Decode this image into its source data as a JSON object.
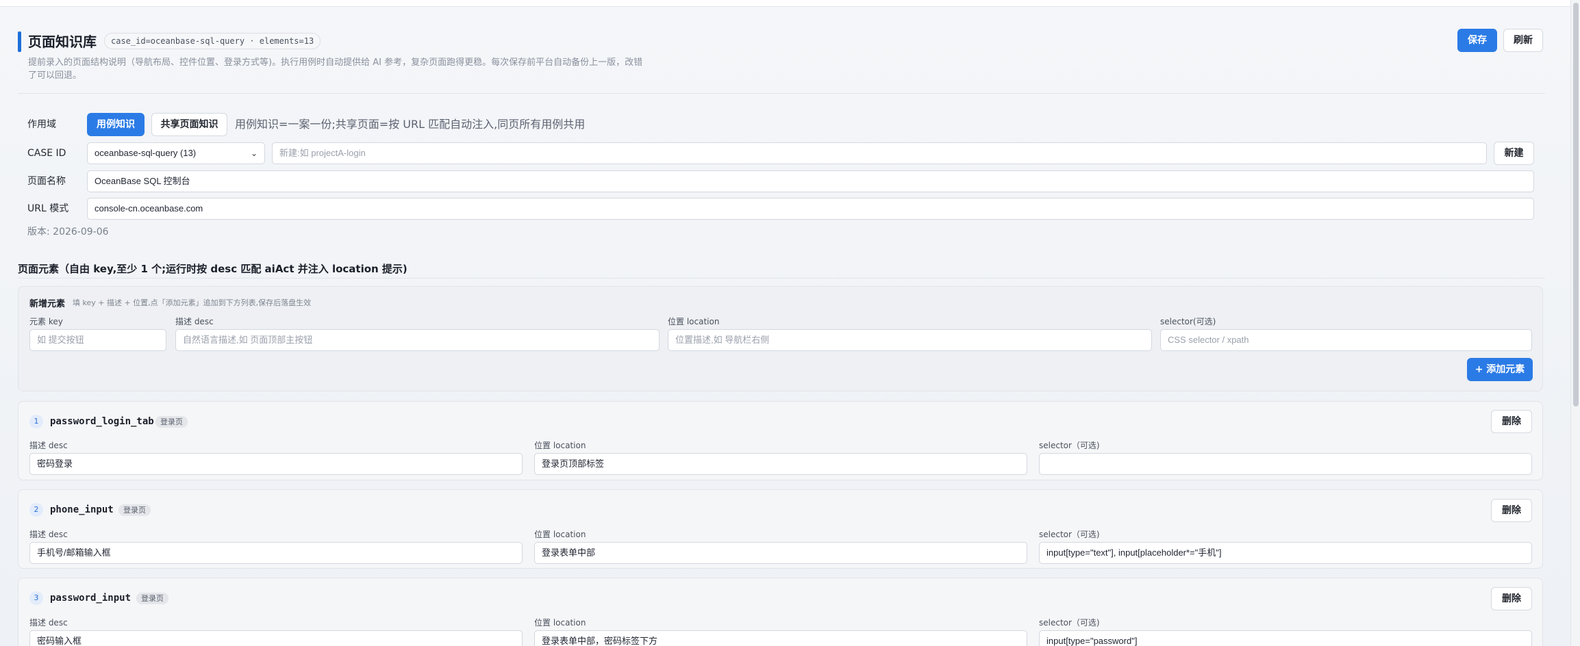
{
  "header": {
    "title": "页面知识库",
    "case_pill": "case_id=oceanbase-sql-query · elements=13",
    "description": "提前录入的页面结构说明（导航布局、控件位置、登录方式等)。执行用例时自动提供给 AI 参考，复杂页面跑得更稳。每次保存前平台自动备份上一版，改错了可以回退。",
    "save_label": "保存",
    "refresh_label": "刷新"
  },
  "scope": {
    "label": "作用域",
    "case_knowledge": "用例知识",
    "shared_knowledge": "共享页面知识",
    "hint": "用例知识=一案一份;共享页面=按 URL 匹配自动注入,同页所有用例共用"
  },
  "case_id": {
    "label": "CASE ID",
    "selected": "oceanbase-sql-query (13)",
    "new_placeholder": "新建:如 projectA-login",
    "new_button": "新建"
  },
  "page_name": {
    "label": "页面名称",
    "value": "OceanBase SQL 控制台"
  },
  "url_pattern": {
    "label": "URL 模式",
    "value": "console-cn.oceanbase.com"
  },
  "version": "版本: 2026-09-06",
  "elements_section": {
    "title": "页面元素（自由 key,至少 1 个;运行时按 desc 匹配 aiAct 并注入 location 提示)"
  },
  "new_element": {
    "title": "新增元素",
    "hint": "填 key + 描述 + 位置,点「添加元素」追加到下方列表,保存后落盘生效",
    "key_label": "元素 key",
    "key_placeholder": "如 提交按钮",
    "desc_label": "描述 desc",
    "desc_placeholder": "自然语言描述,如 页面顶部主按钮",
    "location_label": "位置 location",
    "location_placeholder": "位置描述,如 导航栏右侧",
    "selector_label": "selector(可选)",
    "selector_placeholder": "CSS selector / xpath",
    "add_button": "+ 添加元素"
  },
  "element_labels": {
    "desc": "描述 desc",
    "location": "位置 location",
    "selector": "selector（可选)",
    "delete": "删除"
  },
  "elements": [
    {
      "index": "1",
      "key": "password_login_tab",
      "tag": "登录页",
      "desc": "密码登录",
      "location": "登录页顶部标签",
      "selector": ""
    },
    {
      "index": "2",
      "key": "phone_input",
      "tag": "登录页",
      "desc": "手机号/邮箱输入框",
      "location": "登录表单中部",
      "selector": "input[type=\"text\"], input[placeholder*=\"手机\"]"
    },
    {
      "index": "3",
      "key": "password_input",
      "tag": "登录页",
      "desc": "密码输入框",
      "location": "登录表单中部，密码标签下方",
      "selector": "input[type=\"password\"]"
    }
  ],
  "colors": {
    "accent": "#2b7be6",
    "title_bar": "#1e6fd9"
  }
}
